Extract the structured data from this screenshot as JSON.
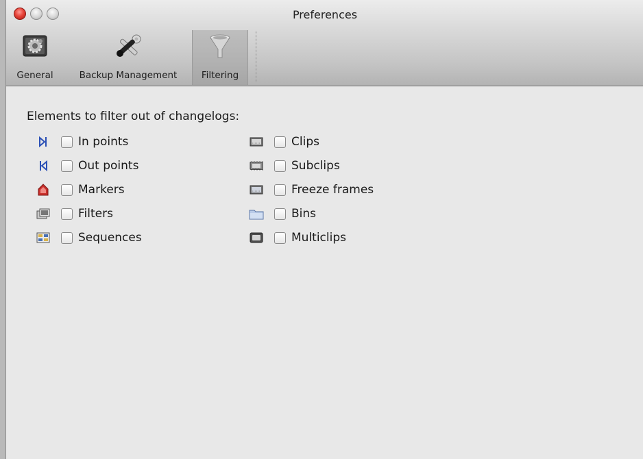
{
  "window": {
    "title": "Preferences"
  },
  "toolbar": {
    "items": [
      {
        "label": "General",
        "icon": "gear-icon"
      },
      {
        "label": "Backup Management",
        "icon": "tools-icon"
      },
      {
        "label": "Filtering",
        "icon": "funnel-icon",
        "selected": true
      }
    ]
  },
  "filtering": {
    "heading": "Elements to filter out of changelogs:",
    "left_column": [
      {
        "label": "In points",
        "icon": "in-point-icon",
        "checked": false
      },
      {
        "label": "Out points",
        "icon": "out-point-icon",
        "checked": false
      },
      {
        "label": "Markers",
        "icon": "marker-icon",
        "checked": false
      },
      {
        "label": "Filters",
        "icon": "filter-effect-icon",
        "checked": false
      },
      {
        "label": "Sequences",
        "icon": "sequence-icon",
        "checked": false
      }
    ],
    "right_column": [
      {
        "label": "Clips",
        "icon": "clip-icon",
        "checked": false
      },
      {
        "label": "Subclips",
        "icon": "subclip-icon",
        "checked": false
      },
      {
        "label": "Freeze frames",
        "icon": "freeze-frame-icon",
        "checked": false
      },
      {
        "label": "Bins",
        "icon": "bin-folder-icon",
        "checked": false
      },
      {
        "label": "Multiclips",
        "icon": "multiclip-icon",
        "checked": false
      }
    ]
  },
  "colors": {
    "close_button": "#e7443a",
    "accent_blue": "#2a4fb5",
    "marker_red": "#c9302c"
  }
}
